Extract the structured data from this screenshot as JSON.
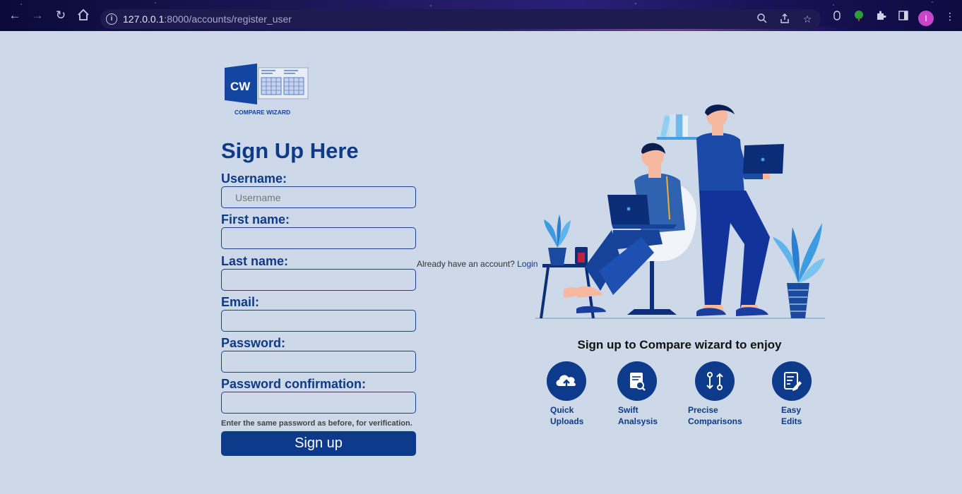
{
  "browser": {
    "url_host": "127.0.0.1",
    "url_rest": ":8000/accounts/register_user",
    "profile_initial": "I"
  },
  "logo": {
    "initials": "CW",
    "caption": "COMPARE WIZARD"
  },
  "form": {
    "title": "Sign Up Here",
    "fields": [
      {
        "label": "Username:",
        "placeholder": "Username"
      },
      {
        "label": "First name:",
        "placeholder": ""
      },
      {
        "label": "Last name:",
        "placeholder": ""
      },
      {
        "label": "Email:",
        "placeholder": ""
      },
      {
        "label": "Password:",
        "placeholder": ""
      },
      {
        "label": "Password confirmation:",
        "placeholder": ""
      }
    ],
    "help_text": "Enter the same password as before, for verification.",
    "submit_label": "Sign up",
    "login_prompt": "Already have an account?",
    "login_link": "Login"
  },
  "promo": {
    "title": "Sign up to Compare wizard to enjoy",
    "features": [
      {
        "label": "Quick\nUploads",
        "icon": "cloud-upload-icon"
      },
      {
        "label": "Swift\nAnalsysis",
        "icon": "document-search-icon"
      },
      {
        "label": "Precise\nComparisons",
        "icon": "compare-arrows-icon"
      },
      {
        "label": "Easy\nEdits",
        "icon": "edit-document-icon"
      }
    ]
  },
  "colors": {
    "primary": "#0d3a8a",
    "background": "#cdd8e8"
  }
}
